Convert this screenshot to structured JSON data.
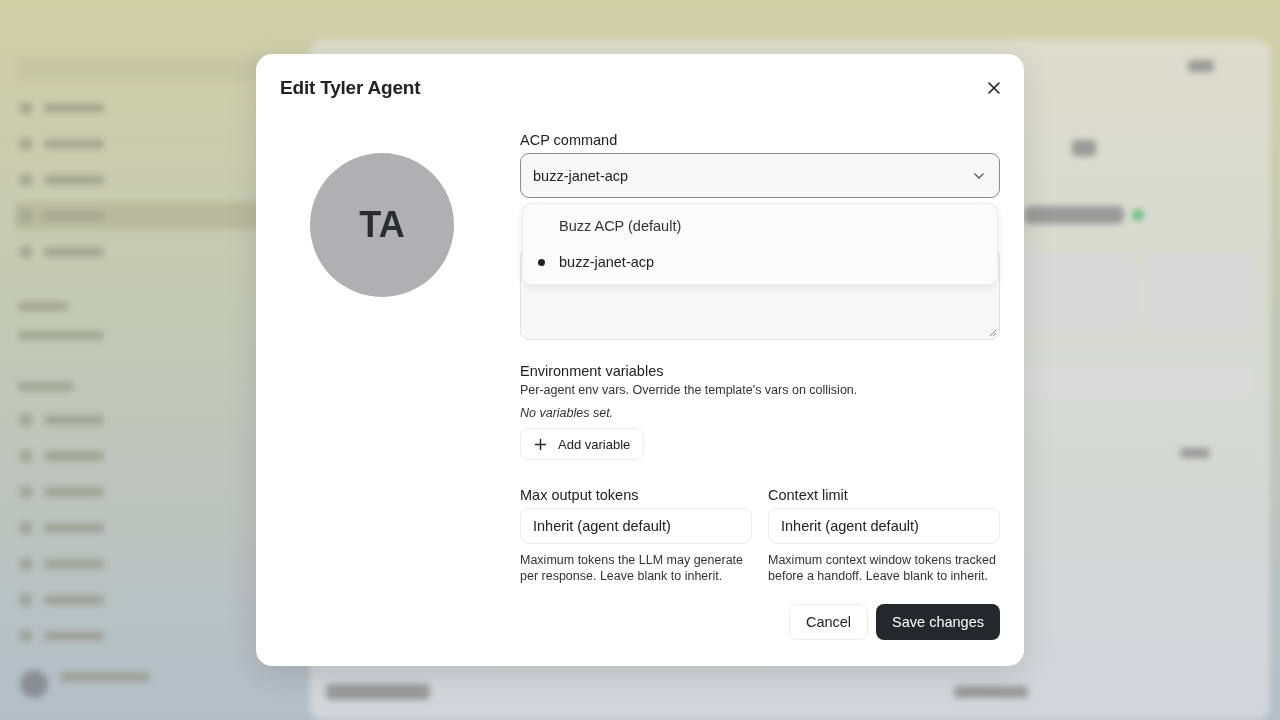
{
  "dialog": {
    "title": "Edit Tyler Agent",
    "avatar_initials": "TA"
  },
  "acp_command": {
    "label": "ACP command",
    "value": "buzz-janet-acp",
    "expanded": true,
    "options": [
      {
        "label": "Buzz ACP (default)",
        "selected": false
      },
      {
        "label": "buzz-janet-acp",
        "selected": true
      }
    ]
  },
  "environment": {
    "title": "Environment variables",
    "description": "Per-agent env vars. Override the template's vars on collision.",
    "empty_text": "No variables set.",
    "add_button": "Add variable"
  },
  "limits": [
    {
      "label": "Max output tokens",
      "placeholder": "Inherit (agent default)",
      "help": "Maximum tokens the LLM may generate per response. Leave blank to inherit."
    },
    {
      "label": "Context limit",
      "placeholder": "Inherit (agent default)",
      "help": "Maximum context window tokens tracked before a handoff. Leave blank to inherit."
    }
  ],
  "buttons": {
    "cancel": "Cancel",
    "save": "Save changes"
  }
}
